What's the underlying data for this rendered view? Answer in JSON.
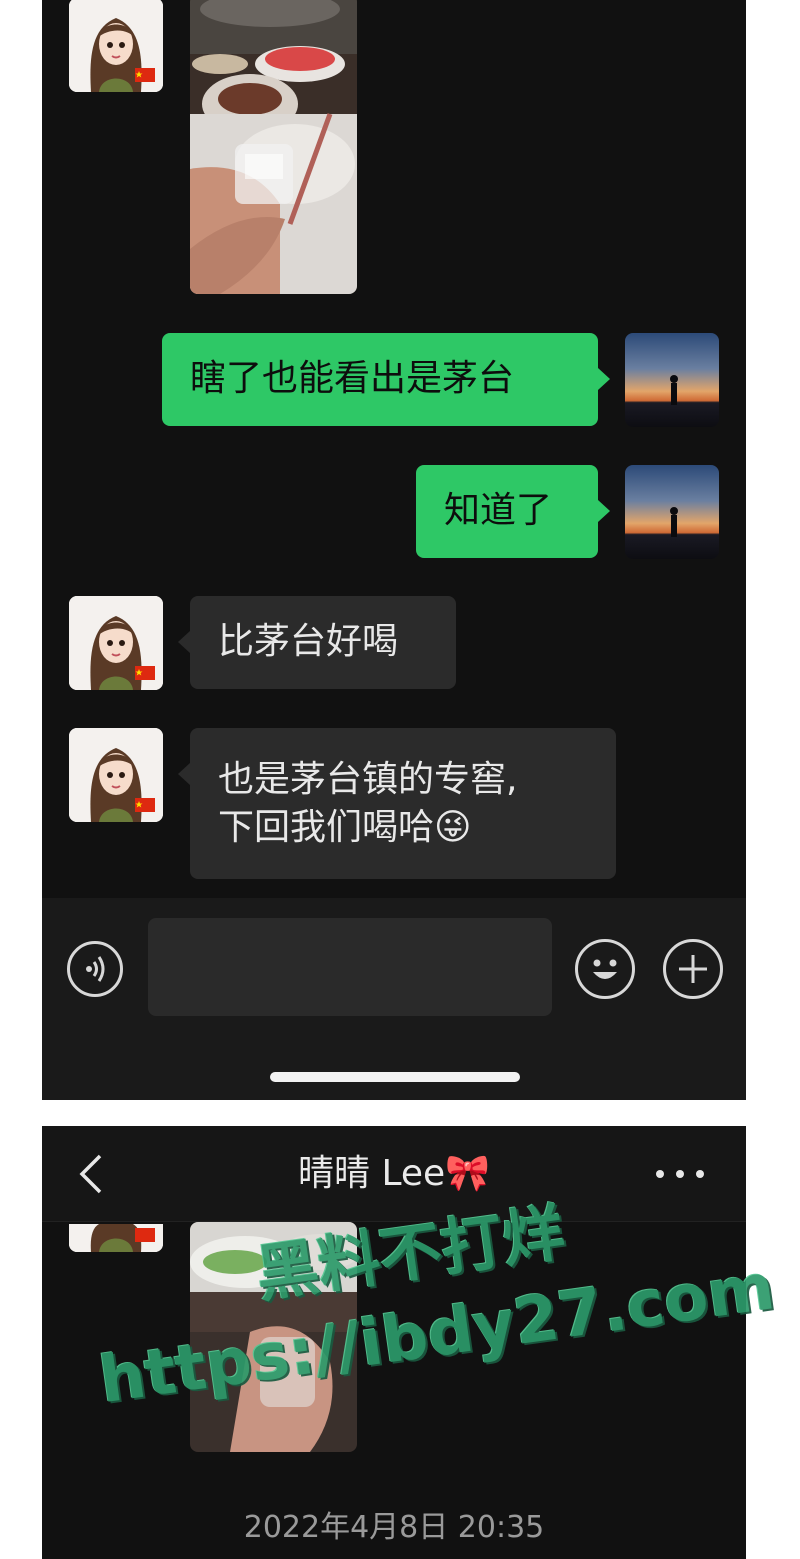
{
  "chat": {
    "messages": [
      {
        "side": "left",
        "type": "image",
        "sender": "girl"
      },
      {
        "side": "right",
        "type": "text",
        "text": "瞎了也能看出是茅台"
      },
      {
        "side": "right",
        "type": "text",
        "text": "知道了"
      },
      {
        "side": "left",
        "type": "text",
        "text": "比茅台好喝"
      },
      {
        "side": "left",
        "type": "text",
        "lines": [
          "也是茅台镇的专窖,",
          "下回我们喝哈"
        ],
        "emoji": "😜"
      }
    ]
  },
  "input_bar": {
    "voice_icon": "voice-icon",
    "emoji_icon": "emoji-icon",
    "plus_icon": "plus-icon"
  },
  "second_screen": {
    "title": "晴晴 Lee",
    "title_emoji": "🎀",
    "more_icon": "more-icon",
    "back_icon": "back-icon",
    "timestamp": "2022年4月8日 20:35"
  },
  "watermark": {
    "line1": "黑料不打烊",
    "line2": "https://ibdy27.com"
  },
  "colors": {
    "bubble_green": "#2ec866",
    "bubble_dark": "#2b2b2b",
    "background": "#111111",
    "watermark": "#2c9a6a"
  }
}
